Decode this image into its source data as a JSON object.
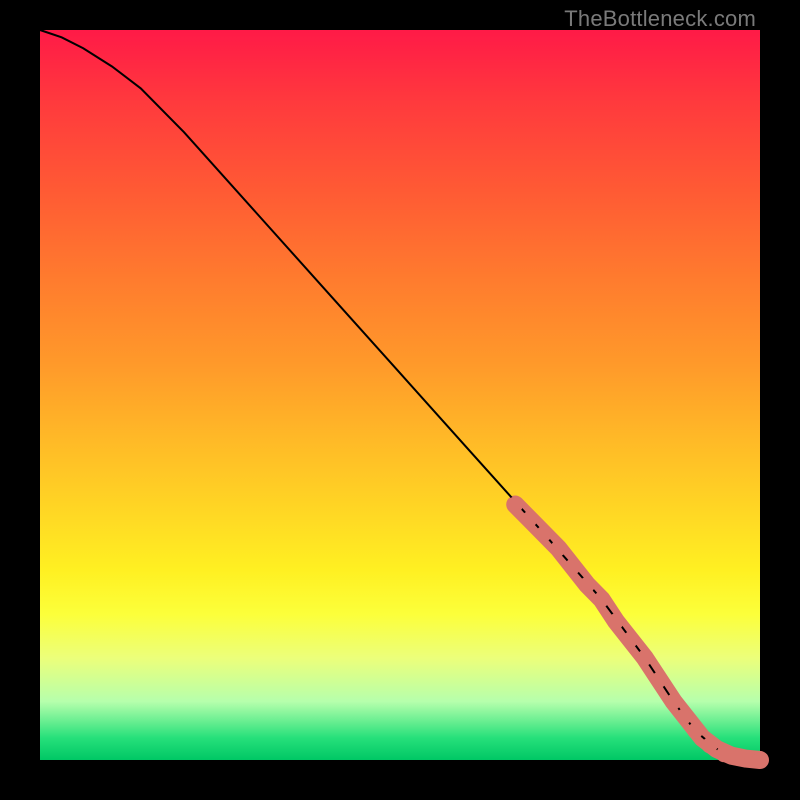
{
  "watermark": "TheBottleneck.com",
  "chart_data": {
    "type": "line",
    "title": "",
    "xlabel": "",
    "ylabel": "",
    "xlim": [
      0,
      100
    ],
    "ylim": [
      0,
      100
    ],
    "grid": false,
    "legend": false,
    "curve": {
      "name": "bottleneck-curve",
      "color": "#000000",
      "x": [
        0,
        3,
        6,
        10,
        14,
        20,
        30,
        40,
        50,
        60,
        70,
        78,
        84,
        88,
        91,
        94,
        97,
        100
      ],
      "y": [
        100,
        99,
        97.5,
        95,
        92,
        86,
        75,
        64,
        53,
        42,
        31,
        22,
        14,
        8,
        4,
        1.5,
        0.3,
        0
      ]
    },
    "highlight_segments": {
      "name": "highlighted-range",
      "color": "#d9736b",
      "x": [
        66,
        68,
        70,
        72,
        74,
        76,
        78,
        80,
        82,
        84,
        86,
        88,
        90,
        92,
        94,
        96,
        98,
        100
      ],
      "y": [
        35,
        33,
        31,
        29,
        26.5,
        24,
        22,
        19,
        16.5,
        14,
        11,
        8,
        5.5,
        3,
        1.5,
        0.6,
        0.2,
        0
      ]
    },
    "scatter_points": {
      "name": "data-points",
      "color": "#d9736b",
      "radius": 8,
      "points": [
        {
          "x": 66,
          "y": 35
        },
        {
          "x": 68,
          "y": 33
        },
        {
          "x": 70,
          "y": 31
        },
        {
          "x": 72,
          "y": 29
        },
        {
          "x": 74,
          "y": 26.5
        },
        {
          "x": 76,
          "y": 24
        },
        {
          "x": 78,
          "y": 22
        },
        {
          "x": 80,
          "y": 19
        },
        {
          "x": 82,
          "y": 16.5
        },
        {
          "x": 84,
          "y": 14
        },
        {
          "x": 86,
          "y": 11
        },
        {
          "x": 88,
          "y": 8
        },
        {
          "x": 89.5,
          "y": 6
        },
        {
          "x": 91,
          "y": 4
        },
        {
          "x": 93,
          "y": 2
        },
        {
          "x": 95,
          "y": 0.8
        },
        {
          "x": 97,
          "y": 0.3
        },
        {
          "x": 99,
          "y": 0.1
        },
        {
          "x": 100,
          "y": 0
        }
      ]
    }
  }
}
